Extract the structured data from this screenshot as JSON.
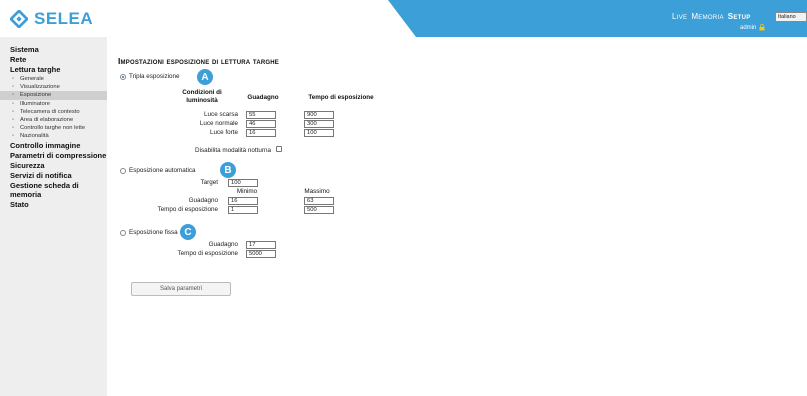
{
  "brand": {
    "name": "SELEA",
    "color": "#3d9fd8"
  },
  "topnav": {
    "live": "Live",
    "memoria": "Memoria",
    "setup": "Setup"
  },
  "language": {
    "selected": "Italiano"
  },
  "user": {
    "name": "admin"
  },
  "sidebar": {
    "groups": [
      "Sistema",
      "Rete",
      "Lettura targhe",
      "Controllo immagine",
      "Parametri di compressione",
      "Sicurezza",
      "Servizi di notifica",
      "Gestione scheda di memoria",
      "Stato"
    ],
    "subitems": [
      "Generale",
      "Visualizzazione",
      "Esposizione",
      "Illuminatore",
      "Telecamera di contesto",
      "Area di elaborazione",
      "Controllo targhe non lette",
      "Nazionalità"
    ],
    "active_subitem": "Esposizione"
  },
  "page": {
    "title": "Impostazioni esposizione di lettura targhe"
  },
  "triple": {
    "label": "Tripla esposizione",
    "badge": "A",
    "headers": {
      "conditions": "Condizioni di luminosità",
      "gain": "Guadagno",
      "exposure": "Tempo di esposizione"
    },
    "rows": [
      {
        "label": "Luce scarsa",
        "gain": "55",
        "exposure": "900"
      },
      {
        "label": "Luce normale",
        "gain": "46",
        "exposure": "300"
      },
      {
        "label": "Luce forte",
        "gain": "16",
        "exposure": "100"
      }
    ],
    "night_label": "Disabilita modalità notturna",
    "night_checked": false
  },
  "auto": {
    "label": "Esposizione automatica",
    "badge": "B",
    "target_label": "Target",
    "target_value": "100",
    "min_label": "Minimo",
    "max_label": "Massimo",
    "gain_label": "Guadagno",
    "gain_min": "16",
    "gain_max": "63",
    "exposure_label": "Tempo di esposizione",
    "exposure_min": "1",
    "exposure_max": "500"
  },
  "fixed": {
    "label": "Esposizione fissa",
    "badge": "C",
    "gain_label": "Guadagno",
    "gain_value": "17",
    "exposure_label": "Tempo di esposizione",
    "exposure_value": "5000"
  },
  "save_label": "Salva parametri",
  "selected_mode": "triple"
}
